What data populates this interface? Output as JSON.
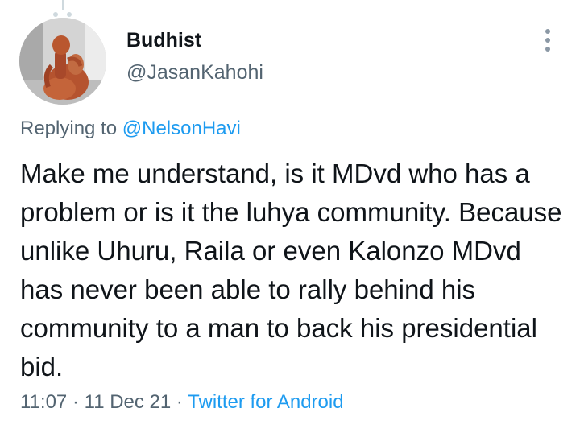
{
  "tweet": {
    "author": {
      "display_name": "Budhist",
      "handle": "@JasanKahohi",
      "avatar_icon": "avatar-photo-clay-sculpture"
    },
    "more_icon": "more-vertical-icon",
    "reply_context": {
      "prefix": "Replying to",
      "handle": "@NelsonHavi"
    },
    "text": "Make me understand, is it MDvd who has a problem or is it the luhya community. Because unlike Uhuru, Raila or even Kalonzo MDvd has never been able to rally behind his community to a man to back his presidential bid.",
    "time": "11:07",
    "separator": "·",
    "date": "11 Dec 21",
    "source": "Twitter for Android"
  },
  "colors": {
    "text_primary": "#0f1419",
    "text_secondary": "#536471",
    "link": "#1d9bf0",
    "thread_line": "#cfd9de"
  }
}
